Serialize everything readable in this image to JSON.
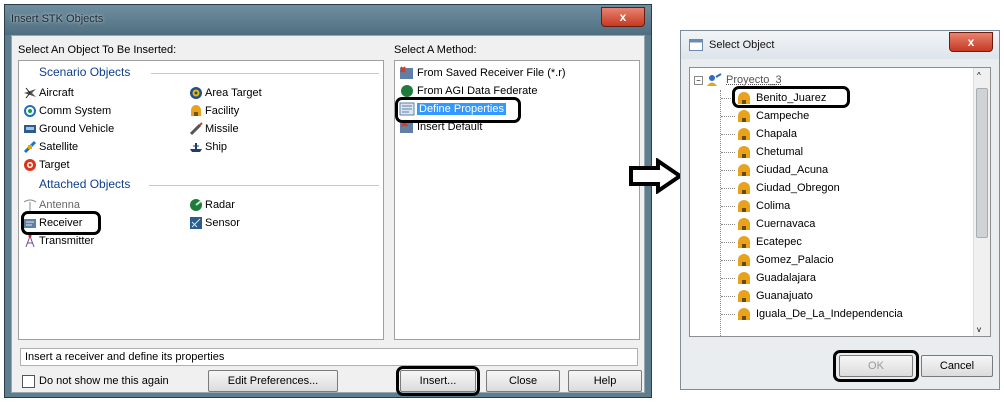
{
  "insert_dialog": {
    "title": "Insert STK Objects",
    "close_glyph": "x",
    "objects_header": "Select An Object To Be Inserted:",
    "methods_header": "Select A Method:",
    "scenario_group": "Scenario Objects",
    "attached_group": "Attached Objects",
    "scenario_objects": [
      {
        "label": "Aircraft",
        "icon": "aircraft-icon"
      },
      {
        "label": "Comm System",
        "icon": "comm-system-icon"
      },
      {
        "label": "Ground Vehicle",
        "icon": "ground-vehicle-icon"
      },
      {
        "label": "Satellite",
        "icon": "satellite-icon"
      },
      {
        "label": "Target",
        "icon": "target-icon"
      },
      {
        "label": "Area Target",
        "icon": "area-target-icon"
      },
      {
        "label": "Facility",
        "icon": "facility-icon"
      },
      {
        "label": "Missile",
        "icon": "missile-icon"
      },
      {
        "label": "Ship",
        "icon": "ship-icon"
      }
    ],
    "attached_objects": [
      {
        "label": "Antenna",
        "icon": "antenna-icon"
      },
      {
        "label": "Receiver",
        "icon": "receiver-icon"
      },
      {
        "label": "Transmitter",
        "icon": "transmitter-icon"
      },
      {
        "label": "Radar",
        "icon": "radar-icon"
      },
      {
        "label": "Sensor",
        "icon": "sensor-icon"
      }
    ],
    "methods": [
      {
        "label": "From Saved Receiver File (*.r)",
        "icon": "receiver-file-icon"
      },
      {
        "label": "From AGI Data Federate",
        "icon": "data-federate-icon"
      },
      {
        "label": "Define Properties",
        "icon": "define-properties-icon",
        "selected": true
      },
      {
        "label": "Insert Default",
        "icon": "insert-default-icon"
      }
    ],
    "status_text": "Insert a receiver and define its properties",
    "checkbox_label": "Do not show me this again",
    "buttons": {
      "edit_preferences": "Edit Preferences...",
      "insert": "Insert...",
      "close": "Close",
      "help": "Help"
    }
  },
  "select_dialog": {
    "title": "Select Object",
    "close_glyph": "x",
    "root": "Proyecto_3",
    "items": [
      "Benito_Juarez",
      "Campeche",
      "Chapala",
      "Chetumal",
      "Ciudad_Acuna",
      "Ciudad_Obregon",
      "Colima",
      "Cuernavaca",
      "Ecatepec",
      "Gomez_Palacio",
      "Guadalajara",
      "Guanajuato",
      "Iguala_De_La_Independencia"
    ],
    "buttons": {
      "ok": "OK",
      "cancel": "Cancel"
    }
  },
  "colors": {
    "group_header": "#0f3f8c",
    "selection": "#3399ff",
    "title_bar": "#5e7d8e",
    "close_button": "#c53a22"
  }
}
